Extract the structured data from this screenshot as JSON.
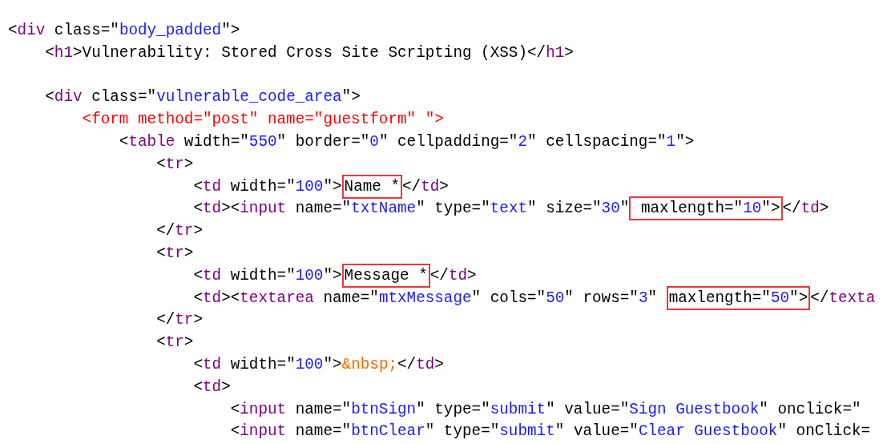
{
  "code_lines": [
    {
      "segments": [
        {
          "boxed": false,
          "tokens": [
            {
              "kind": "plain",
              "text": "<"
            },
            {
              "kind": "tag",
              "text": "div"
            },
            {
              "kind": "plain",
              "text": " class=\""
            },
            {
              "kind": "value",
              "text": "body_padded"
            },
            {
              "kind": "plain",
              "text": "\">"
            }
          ]
        }
      ]
    },
    {
      "segments": [
        {
          "boxed": false,
          "tokens": [
            {
              "kind": "plain",
              "text": "    <"
            },
            {
              "kind": "tag",
              "text": "h1"
            },
            {
              "kind": "plain",
              "text": ">Vulnerability: Stored Cross Site Scripting (XSS)</"
            },
            {
              "kind": "tag",
              "text": "h1"
            },
            {
              "kind": "plain",
              "text": ">"
            }
          ]
        }
      ]
    },
    {
      "gap_before": true,
      "segments": [
        {
          "boxed": false,
          "tokens": [
            {
              "kind": "plain",
              "text": "    <"
            },
            {
              "kind": "tag",
              "text": "div"
            },
            {
              "kind": "plain",
              "text": " class=\""
            },
            {
              "kind": "value",
              "text": "vulnerable_code_area"
            },
            {
              "kind": "plain",
              "text": "\">"
            }
          ]
        }
      ]
    },
    {
      "segments": [
        {
          "boxed": false,
          "tokens": [
            {
              "kind": "error",
              "text": "        <form method=\"post\" name=\"guestform\" \">"
            }
          ]
        }
      ]
    },
    {
      "segments": [
        {
          "boxed": false,
          "tokens": [
            {
              "kind": "plain",
              "text": "            <"
            },
            {
              "kind": "tag",
              "text": "table"
            },
            {
              "kind": "plain",
              "text": " width=\""
            },
            {
              "kind": "value",
              "text": "550"
            },
            {
              "kind": "plain",
              "text": "\" border=\""
            },
            {
              "kind": "value",
              "text": "0"
            },
            {
              "kind": "plain",
              "text": "\" cellpadding=\""
            },
            {
              "kind": "value",
              "text": "2"
            },
            {
              "kind": "plain",
              "text": "\" cellspacing=\""
            },
            {
              "kind": "value",
              "text": "1"
            },
            {
              "kind": "plain",
              "text": "\">"
            }
          ]
        }
      ]
    },
    {
      "segments": [
        {
          "boxed": false,
          "tokens": [
            {
              "kind": "plain",
              "text": "                <"
            },
            {
              "kind": "tag",
              "text": "tr"
            },
            {
              "kind": "plain",
              "text": ">"
            }
          ]
        }
      ]
    },
    {
      "segments": [
        {
          "boxed": false,
          "tokens": [
            {
              "kind": "plain",
              "text": "                    <"
            },
            {
              "kind": "tag",
              "text": "td"
            },
            {
              "kind": "plain",
              "text": " width=\""
            },
            {
              "kind": "value",
              "text": "100"
            },
            {
              "kind": "plain",
              "text": "\">"
            }
          ]
        },
        {
          "boxed": true,
          "tokens": [
            {
              "kind": "plain",
              "text": "Name *"
            }
          ]
        },
        {
          "boxed": false,
          "tokens": [
            {
              "kind": "plain",
              "text": "</"
            },
            {
              "kind": "tag",
              "text": "td"
            },
            {
              "kind": "plain",
              "text": ">"
            }
          ]
        }
      ]
    },
    {
      "segments": [
        {
          "boxed": false,
          "tokens": [
            {
              "kind": "plain",
              "text": "                    <"
            },
            {
              "kind": "tag",
              "text": "td"
            },
            {
              "kind": "plain",
              "text": "><"
            },
            {
              "kind": "tag",
              "text": "input"
            },
            {
              "kind": "plain",
              "text": " name=\""
            },
            {
              "kind": "value",
              "text": "txtName"
            },
            {
              "kind": "plain",
              "text": "\" type=\""
            },
            {
              "kind": "value",
              "text": "text"
            },
            {
              "kind": "plain",
              "text": "\" size=\""
            },
            {
              "kind": "value",
              "text": "30"
            },
            {
              "kind": "plain",
              "text": "\""
            }
          ]
        },
        {
          "boxed": true,
          "tokens": [
            {
              "kind": "plain",
              "text": " maxlength=\""
            },
            {
              "kind": "value",
              "text": "10"
            },
            {
              "kind": "plain",
              "text": "\">"
            }
          ]
        },
        {
          "boxed": false,
          "tokens": [
            {
              "kind": "plain",
              "text": "</"
            },
            {
              "kind": "tag",
              "text": "td"
            },
            {
              "kind": "plain",
              "text": ">"
            }
          ]
        }
      ]
    },
    {
      "segments": [
        {
          "boxed": false,
          "tokens": [
            {
              "kind": "plain",
              "text": "                </"
            },
            {
              "kind": "tag",
              "text": "tr"
            },
            {
              "kind": "plain",
              "text": ">"
            }
          ]
        }
      ]
    },
    {
      "segments": [
        {
          "boxed": false,
          "tokens": [
            {
              "kind": "plain",
              "text": "                <"
            },
            {
              "kind": "tag",
              "text": "tr"
            },
            {
              "kind": "plain",
              "text": ">"
            }
          ]
        }
      ]
    },
    {
      "segments": [
        {
          "boxed": false,
          "tokens": [
            {
              "kind": "plain",
              "text": "                    <"
            },
            {
              "kind": "tag",
              "text": "td"
            },
            {
              "kind": "plain",
              "text": " width=\""
            },
            {
              "kind": "value",
              "text": "100"
            },
            {
              "kind": "plain",
              "text": "\">"
            }
          ]
        },
        {
          "boxed": true,
          "tokens": [
            {
              "kind": "plain",
              "text": "Message *"
            }
          ]
        },
        {
          "boxed": false,
          "tokens": [
            {
              "kind": "plain",
              "text": "</"
            },
            {
              "kind": "tag",
              "text": "td"
            },
            {
              "kind": "plain",
              "text": ">"
            }
          ]
        }
      ]
    },
    {
      "segments": [
        {
          "boxed": false,
          "tokens": [
            {
              "kind": "plain",
              "text": "                    <"
            },
            {
              "kind": "tag",
              "text": "td"
            },
            {
              "kind": "plain",
              "text": "><"
            },
            {
              "kind": "tag",
              "text": "textarea"
            },
            {
              "kind": "plain",
              "text": " name=\""
            },
            {
              "kind": "value",
              "text": "mtxMessage"
            },
            {
              "kind": "plain",
              "text": "\" cols=\""
            },
            {
              "kind": "value",
              "text": "50"
            },
            {
              "kind": "plain",
              "text": "\" rows=\""
            },
            {
              "kind": "value",
              "text": "3"
            },
            {
              "kind": "plain",
              "text": "\" "
            }
          ]
        },
        {
          "boxed": true,
          "tokens": [
            {
              "kind": "plain",
              "text": "maxlength=\""
            },
            {
              "kind": "value",
              "text": "50"
            },
            {
              "kind": "plain",
              "text": "\">"
            }
          ]
        },
        {
          "boxed": false,
          "tokens": [
            {
              "kind": "plain",
              "text": "</"
            },
            {
              "kind": "tag",
              "text": "texta"
            }
          ]
        }
      ]
    },
    {
      "segments": [
        {
          "boxed": false,
          "tokens": [
            {
              "kind": "plain",
              "text": "                </"
            },
            {
              "kind": "tag",
              "text": "tr"
            },
            {
              "kind": "plain",
              "text": ">"
            }
          ]
        }
      ]
    },
    {
      "segments": [
        {
          "boxed": false,
          "tokens": [
            {
              "kind": "plain",
              "text": "                <"
            },
            {
              "kind": "tag",
              "text": "tr"
            },
            {
              "kind": "plain",
              "text": ">"
            }
          ]
        }
      ]
    },
    {
      "segments": [
        {
          "boxed": false,
          "tokens": [
            {
              "kind": "plain",
              "text": "                    <"
            },
            {
              "kind": "tag",
              "text": "td"
            },
            {
              "kind": "plain",
              "text": " width=\""
            },
            {
              "kind": "value",
              "text": "100"
            },
            {
              "kind": "plain",
              "text": "\">"
            },
            {
              "kind": "entity",
              "text": "&nbsp;"
            },
            {
              "kind": "plain",
              "text": "</"
            },
            {
              "kind": "tag",
              "text": "td"
            },
            {
              "kind": "plain",
              "text": ">"
            }
          ]
        }
      ]
    },
    {
      "segments": [
        {
          "boxed": false,
          "tokens": [
            {
              "kind": "plain",
              "text": "                    <"
            },
            {
              "kind": "tag",
              "text": "td"
            },
            {
              "kind": "plain",
              "text": ">"
            }
          ]
        }
      ]
    },
    {
      "segments": [
        {
          "boxed": false,
          "tokens": [
            {
              "kind": "plain",
              "text": "                        <"
            },
            {
              "kind": "tag",
              "text": "input"
            },
            {
              "kind": "plain",
              "text": " name=\""
            },
            {
              "kind": "value",
              "text": "btnSign"
            },
            {
              "kind": "plain",
              "text": "\" type=\""
            },
            {
              "kind": "value",
              "text": "submit"
            },
            {
              "kind": "plain",
              "text": "\" value=\""
            },
            {
              "kind": "value",
              "text": "Sign Guestbook"
            },
            {
              "kind": "plain",
              "text": "\" onclick=\""
            }
          ]
        }
      ]
    },
    {
      "segments": [
        {
          "boxed": false,
          "tokens": [
            {
              "kind": "plain",
              "text": "                        <"
            },
            {
              "kind": "tag",
              "text": "input"
            },
            {
              "kind": "plain",
              "text": " name=\""
            },
            {
              "kind": "value",
              "text": "btnClear"
            },
            {
              "kind": "plain",
              "text": "\" type=\""
            },
            {
              "kind": "value",
              "text": "submit"
            },
            {
              "kind": "plain",
              "text": "\" value=\""
            },
            {
              "kind": "value",
              "text": "Clear Guestbook"
            },
            {
              "kind": "plain",
              "text": "\" onClick="
            }
          ]
        }
      ]
    }
  ]
}
